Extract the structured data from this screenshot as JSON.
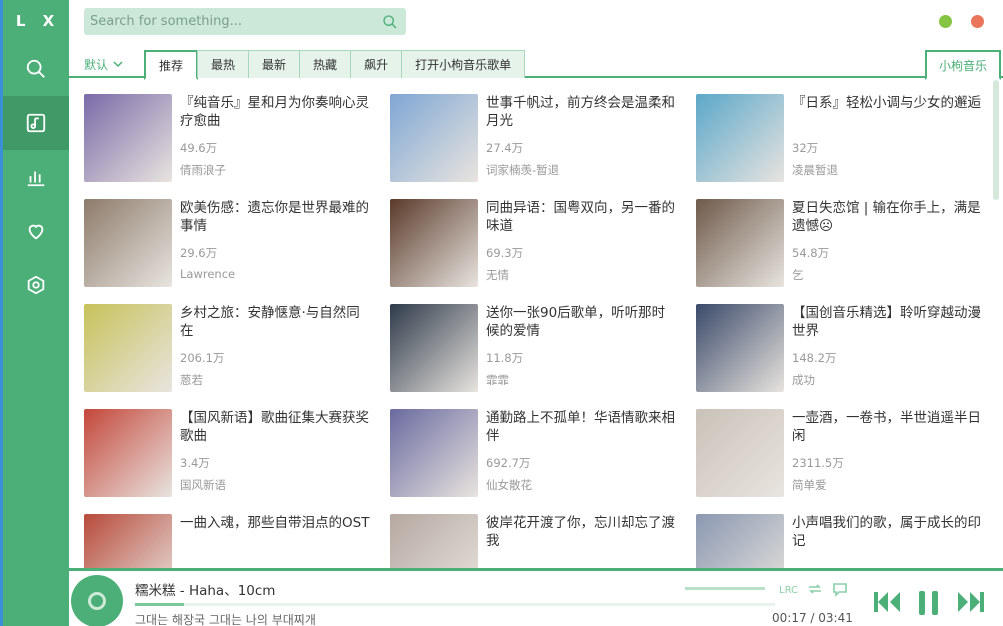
{
  "app": {
    "logo": "L X"
  },
  "sidebar": {
    "items": [
      {
        "name": "search-icon"
      },
      {
        "name": "music-icon"
      },
      {
        "name": "chart-icon"
      },
      {
        "name": "heart-icon"
      },
      {
        "name": "settings-icon"
      }
    ]
  },
  "search": {
    "placeholder": "Search for something..."
  },
  "tabs": {
    "source": "默认",
    "items": [
      "推荐",
      "最热",
      "最新",
      "热藏",
      "飙升",
      "打开小枸音乐歌单"
    ],
    "right": "小枸音乐"
  },
  "playlists": [
    {
      "title": "『纯音乐』星和月为你奏响心灵疗愈曲",
      "plays": "49.6万",
      "author": "倩雨浪子",
      "color": "#7a6aa8"
    },
    {
      "title": "世事千帆过，前方终会是温柔和月光",
      "plays": "27.4万",
      "author": "词家楠羡-暂退",
      "color": "#7fa6d4"
    },
    {
      "title": "『日系』轻松小调与少女的邂逅",
      "plays": "32万",
      "author": "凌晨暂退",
      "color": "#5ba7c9"
    },
    {
      "title": "欧美伤感：遗忘你是世界最难的事情",
      "plays": "29.6万",
      "author": "Lawrence",
      "color": "#8d7b6a"
    },
    {
      "title": "同曲异语：国粤双向，另一番的味道",
      "plays": "69.3万",
      "author": "无情",
      "color": "#5a3a2a"
    },
    {
      "title": "夏日失恋馆 | 输在你手上，满是遗憾☹",
      "plays": "54.8万",
      "author": "乞",
      "color": "#6e5a4a"
    },
    {
      "title": "乡村之旅：安静惬意·与自然同在",
      "plays": "206.1万",
      "author": "蒽若",
      "color": "#c7c25a"
    },
    {
      "title": "送你一张90后歌单，听听那时候的爱情",
      "plays": "11.8万",
      "author": "霏霏",
      "color": "#2e3a4a"
    },
    {
      "title": "【国创音乐精选】聆听穿越动漫世界",
      "plays": "148.2万",
      "author": "成功",
      "color": "#3a4a6a"
    },
    {
      "title": "【国风新语】歌曲征集大赛获奖歌曲",
      "plays": "3.4万",
      "author": "国风新语",
      "color": "#c4473a"
    },
    {
      "title": "通勤路上不孤单！华语情歌来相伴",
      "plays": "692.7万",
      "author": "仙女散花",
      "color": "#6a6aa0"
    },
    {
      "title": "一壶酒，一卷书，半世逍遥半日闲",
      "plays": "2311.5万",
      "author": "简单爱",
      "color": "#c9c2b8"
    },
    {
      "title": "一曲入魂，那些自带泪点的OST",
      "plays": "",
      "author": "",
      "color": "#b84a3a"
    },
    {
      "title": "彼岸花开渡了你，忘川却忘了渡我",
      "plays": "",
      "author": "",
      "color": "#b5a8a0"
    },
    {
      "title": "小声唱我们的歌，属于成长的印记",
      "plays": "",
      "author": "",
      "color": "#8a98b0"
    }
  ],
  "player": {
    "song": "糯米糕 - Haha、10cm",
    "lyric": "그대는 해장국 그대는 나의 부대찌개",
    "time": "00:17 / 03:41",
    "progress": 0.077,
    "lrc_label": "LRC"
  },
  "colors": {
    "accent": "#4caf78"
  }
}
